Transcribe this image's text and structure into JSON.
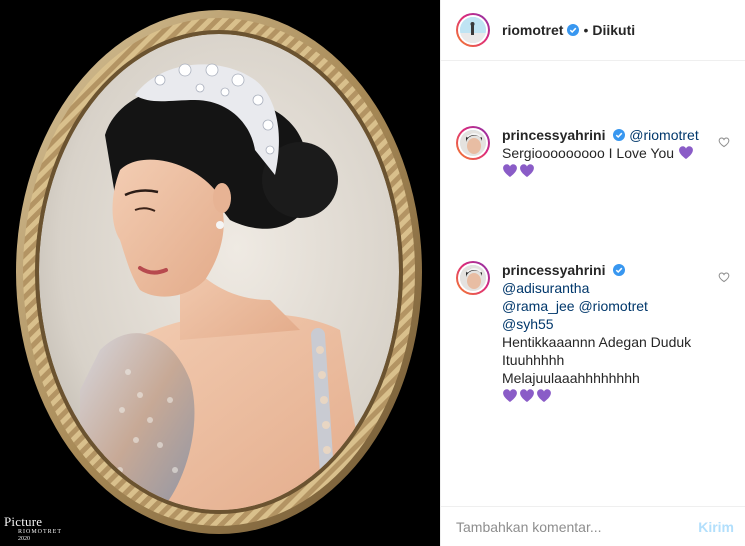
{
  "photo": {
    "alt": "portrait-in-oval-frame",
    "watermark": {
      "name": "Picture",
      "sub": "RIOMOTRET",
      "year": "2020"
    }
  },
  "post_header": {
    "username": "riomotret",
    "separator": "•",
    "follow_status": "Diikuti",
    "verified_icon": "verified-badge-icon"
  },
  "comments": [
    {
      "username": "princessyahrini",
      "verified": true,
      "mentions": [
        "@riomotret"
      ],
      "text": "Sergiooooooooo I Love You",
      "heart_emoji_inline": 1,
      "heart_emoji_line": 2
    },
    {
      "username": "princessyahrini",
      "verified": true,
      "mentions_line1": "@adisurantha",
      "mentions_line2": [
        "@rama_jee",
        "@riomotret",
        "@syh55"
      ],
      "text": "Hentikkaaannn Adegan Duduk Ituuhhhhh Melajuulaaahhhhhhhh",
      "heart_emoji_line": 3
    }
  ],
  "add_comment": {
    "placeholder": "Tambahkan komentar...",
    "post_label": "Kirim"
  },
  "colors": {
    "accent_post_disabled": "#b2dffc",
    "mention": "#00376b",
    "verified": "#3897f0",
    "emoji_heart": "#8a5cc7"
  }
}
